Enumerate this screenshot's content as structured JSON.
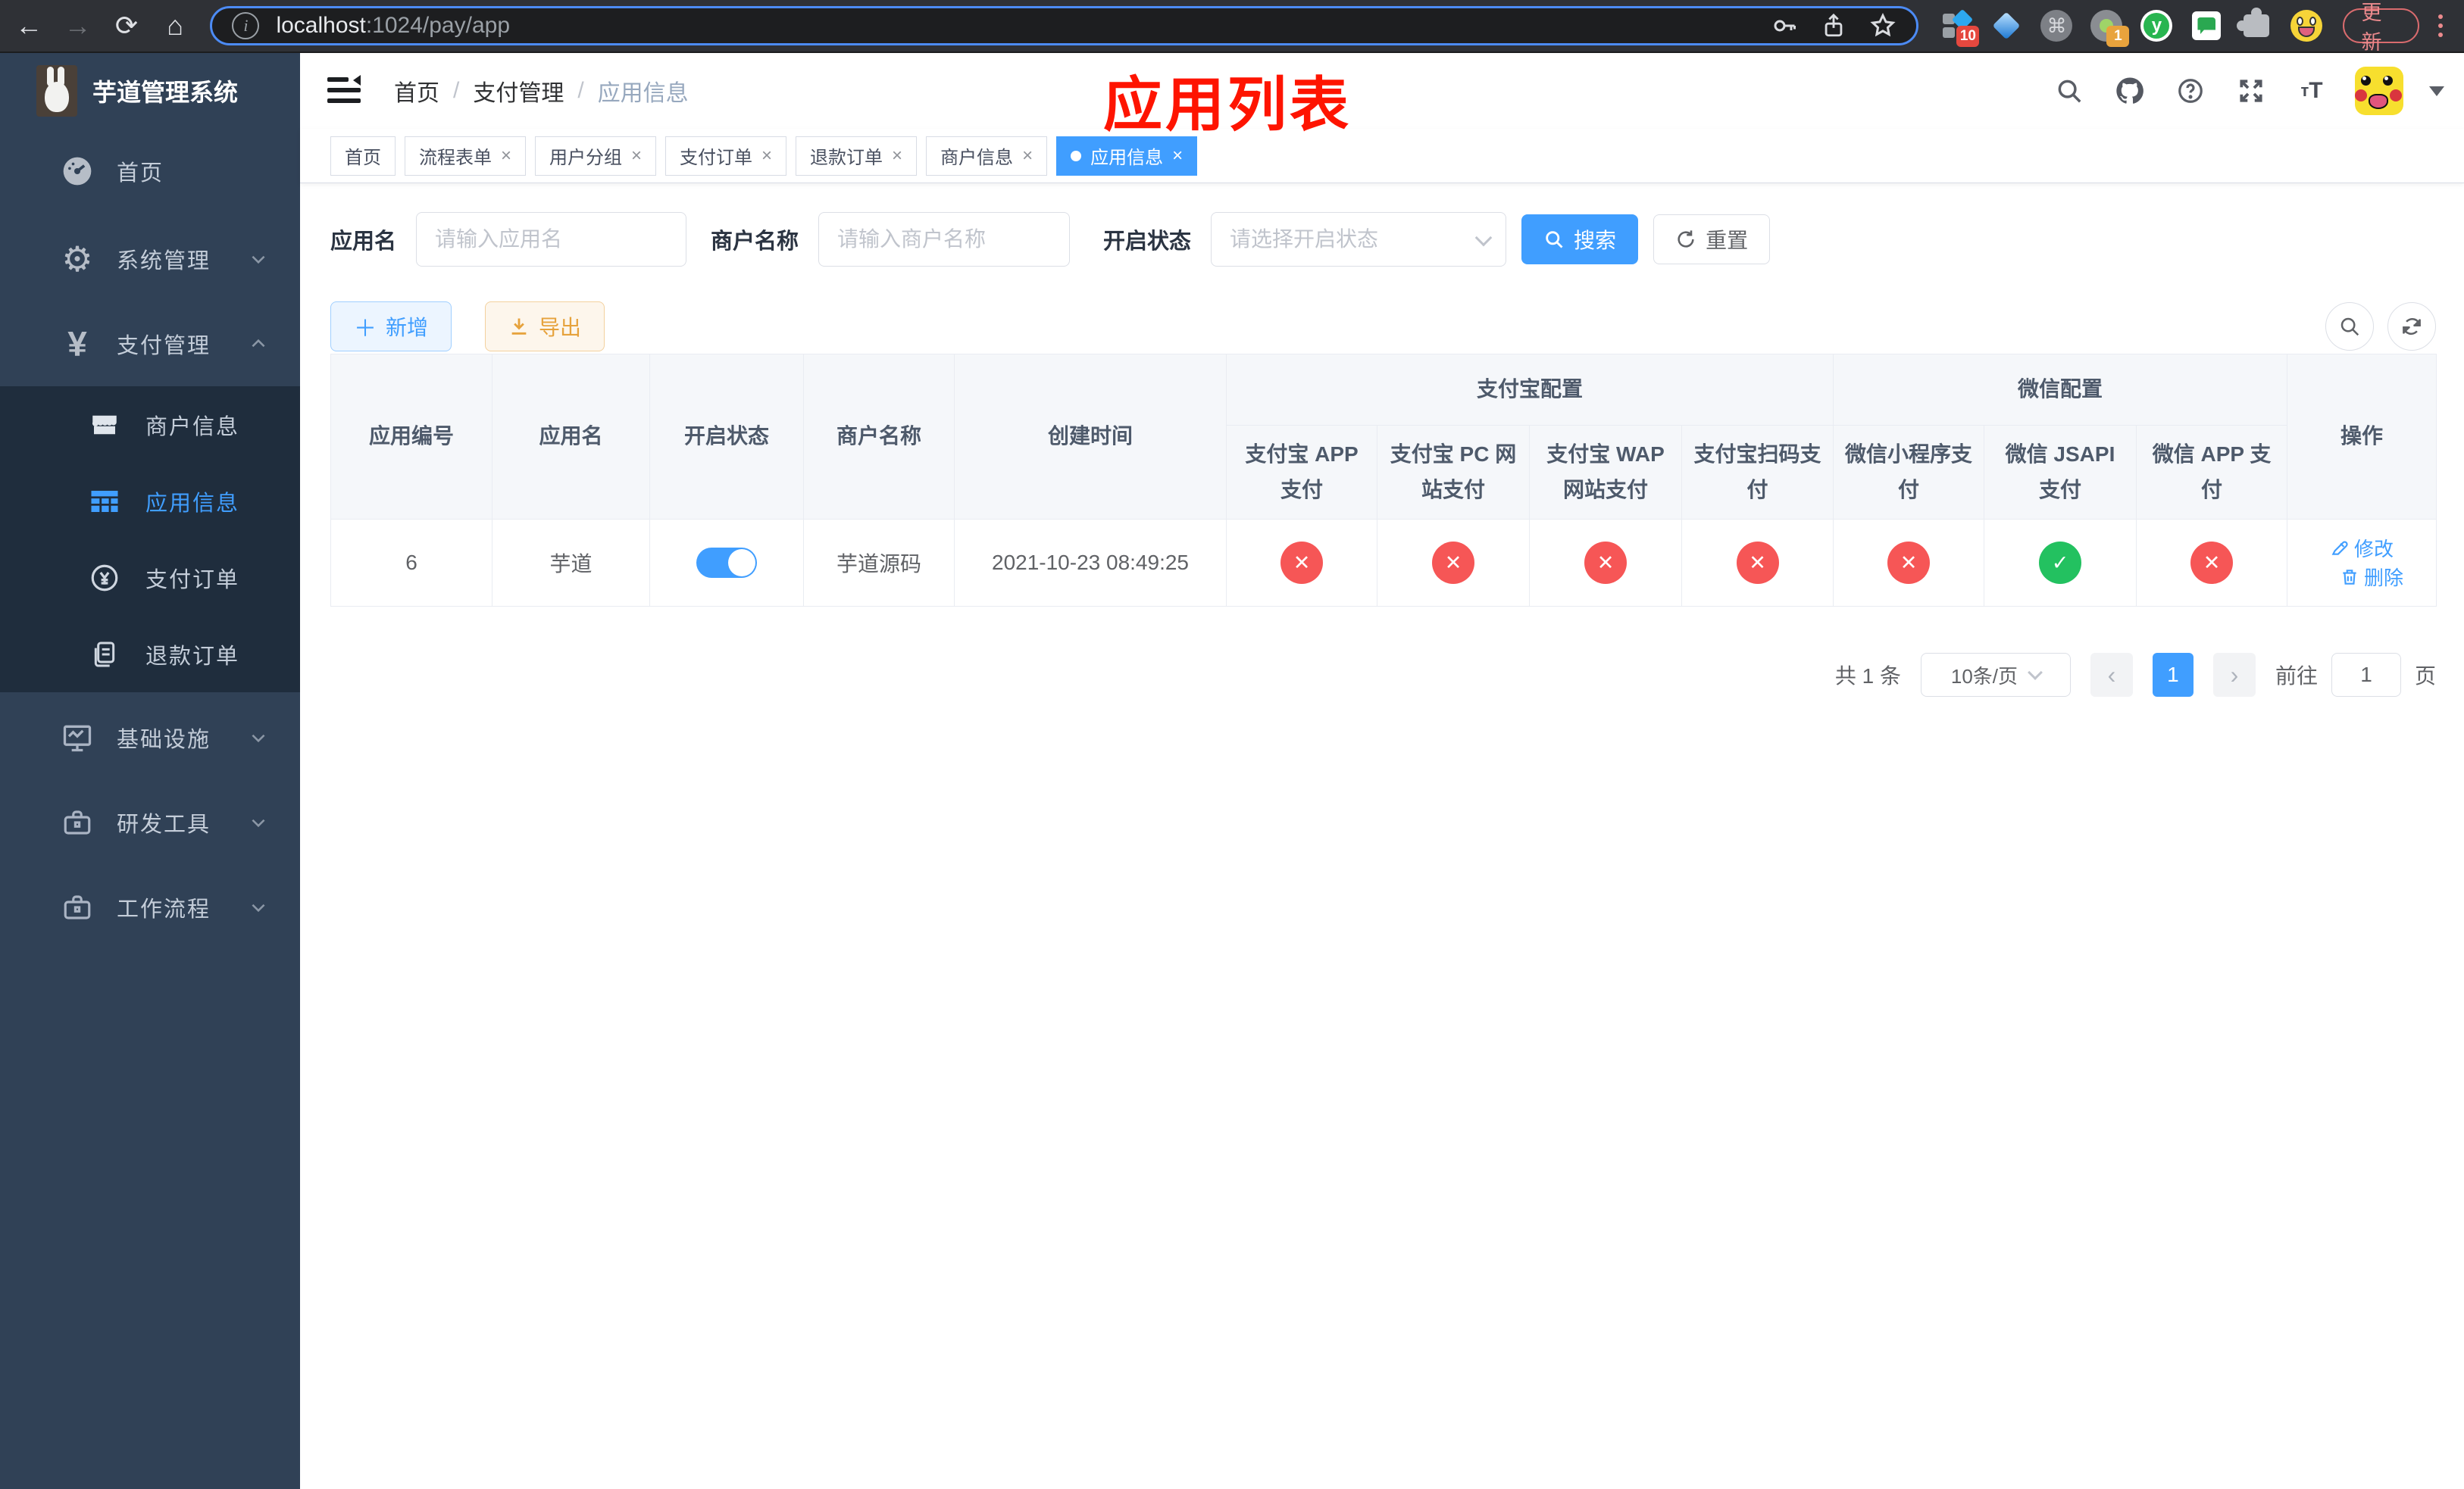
{
  "chrome": {
    "url_host": "localhost",
    "url_path": ":1024/pay/app",
    "update_label": "更新",
    "ext_badge_pinned": "10",
    "ext_badge_recorder": "1"
  },
  "sidebar": {
    "title": "芋道管理系统",
    "items": [
      {
        "label": "首页",
        "icon": "dashboard-icon",
        "chevron": ""
      },
      {
        "label": "系统管理",
        "icon": "gear-icon",
        "chevron": "down"
      },
      {
        "label": "支付管理",
        "icon": "yen-icon",
        "chevron": "up"
      },
      {
        "label": "基础设施",
        "icon": "monitor-icon",
        "chevron": "down"
      },
      {
        "label": "研发工具",
        "icon": "toolbox-icon",
        "chevron": "down"
      },
      {
        "label": "工作流程",
        "icon": "briefcase-icon",
        "chevron": "down"
      }
    ],
    "submenu": [
      {
        "label": "商户信息",
        "icon": "shop-icon",
        "active": false
      },
      {
        "label": "应用信息",
        "icon": "grid-icon",
        "active": true
      },
      {
        "label": "支付订单",
        "icon": "coin-icon",
        "active": false
      },
      {
        "label": "退款订单",
        "icon": "documents-icon",
        "active": false
      }
    ]
  },
  "navbar": {
    "breadcrumb": [
      "首页",
      "支付管理",
      "应用信息"
    ],
    "separator": "/"
  },
  "annotation": "应用列表",
  "tabs": [
    {
      "label": "首页",
      "closable": false,
      "active": false
    },
    {
      "label": "流程表单",
      "closable": true,
      "active": false
    },
    {
      "label": "用户分组",
      "closable": true,
      "active": false
    },
    {
      "label": "支付订单",
      "closable": true,
      "active": false
    },
    {
      "label": "退款订单",
      "closable": true,
      "active": false
    },
    {
      "label": "商户信息",
      "closable": true,
      "active": false
    },
    {
      "label": "应用信息",
      "closable": true,
      "active": true
    }
  ],
  "filters": {
    "app_name_label": "应用名",
    "app_name_placeholder": "请输入应用名",
    "merchant_label": "商户名称",
    "merchant_placeholder": "请输入商户名称",
    "status_label": "开启状态",
    "status_placeholder": "请选择开启状态",
    "search_label": "搜索",
    "reset_label": "重置"
  },
  "toolbar": {
    "add_label": "新增",
    "export_label": "导出"
  },
  "table": {
    "group_alipay": "支付宝配置",
    "group_wechat": "微信配置",
    "cols_left": [
      "应用编号",
      "应用名",
      "开启状态",
      "商户名称",
      "创建时间"
    ],
    "cols_alipay": [
      "支付宝 APP 支付",
      "支付宝 PC 网站支付",
      "支付宝 WAP 网站支付",
      "支付宝扫码支付"
    ],
    "cols_wechat": [
      "微信小程序支付",
      "微信 JSAPI 支付",
      "微信 APP 支付"
    ],
    "col_action": "操作",
    "row": {
      "id": "6",
      "name": "芋道",
      "enabled": true,
      "merchant": "芋道源码",
      "created_at": "2021-10-23 08:49:25",
      "channels": [
        false,
        false,
        false,
        false,
        false,
        true,
        false
      ],
      "edit_label": "修改",
      "delete_label": "删除"
    }
  },
  "pagination": {
    "total": "共 1 条",
    "page_size": "10条/页",
    "page": "1",
    "prev": "‹",
    "next": "›",
    "goto_label": "前往",
    "goto_value": "1",
    "goto_unit": "页"
  },
  "icons": {
    "ok": "✓",
    "fail": "✕"
  },
  "colors": {
    "accent": "#409eff",
    "danger": "#f65656",
    "success": "#23c160",
    "warning": "#e6a23c",
    "sidebar": "#304156",
    "submenu": "#1f2d3d"
  }
}
